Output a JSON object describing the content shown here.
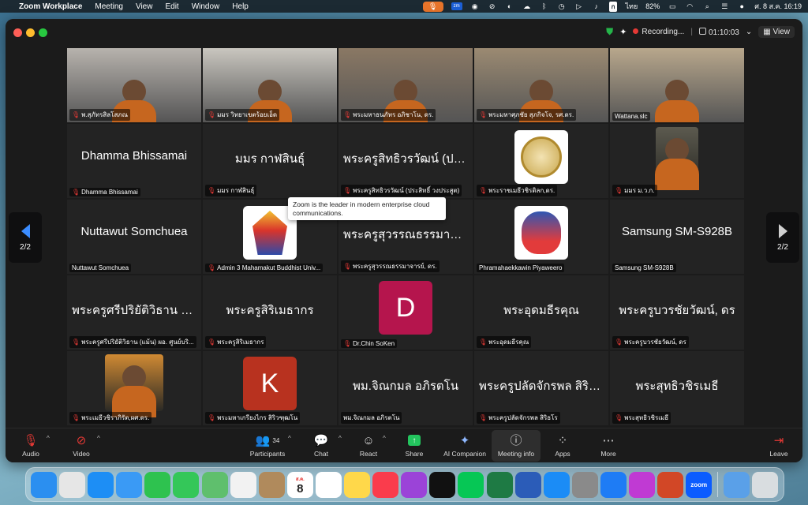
{
  "menubar": {
    "app_name": "Zoom Workplace",
    "items": [
      "Meeting",
      "View",
      "Edit",
      "Window",
      "Help"
    ],
    "zm_icon": "zm",
    "lang": "ไทย",
    "battery": "82%",
    "clock": "ศ. 8 ส.ค.  16:19"
  },
  "titlebar": {
    "recording": "Recording...",
    "timer": "01:10:03",
    "view": "View"
  },
  "nav": {
    "left_page": "2/2",
    "right_page": "2/2"
  },
  "tooltip": "Zoom is the leader in modern enterprise cloud communications.",
  "tiles": [
    {
      "type": "video",
      "tag": "พ.สุภัทรสิลโสภณ",
      "bg": "#b7b3ad"
    },
    {
      "type": "video",
      "tag": "มมร วิทยาเขตร้อยเอ็ด",
      "bg": "#c9c6bf"
    },
    {
      "type": "video",
      "tag": "พระมหาธนภัทร อภิชาโน, ดร.",
      "bg": "#8a7864"
    },
    {
      "type": "video",
      "tag": "พระมหาศุภชัย สุภกิจโจ, รศ.ดร.",
      "bg": "#9b8a72"
    },
    {
      "type": "video",
      "tag": "Wattana.slc",
      "bg": "#b8a78c",
      "muted": false
    },
    {
      "type": "name",
      "name": "Dhamma Bhissamai",
      "tag": "Dhamma Bhissamai"
    },
    {
      "type": "name",
      "name": "มมร กาฬสินธุ์",
      "tag": "มมร กาฬสินธุ์"
    },
    {
      "type": "name",
      "name": "พระครูสิทธิวรวัฒน์ (ประ...",
      "tag": "พระครูสิทธิวรวัฒน์ (ประสิทธิ์ วงประสูต)"
    },
    {
      "type": "logo",
      "tag": "พระราชเมธีวชิรดิลก,ดร.",
      "logo": "seal-gold"
    },
    {
      "type": "photo",
      "tag": "มมร ม.ว.ก.",
      "bg": "#5c5a4f"
    },
    {
      "type": "name",
      "name": "Nuttawut Somchuea",
      "tag": "Nuttawut Somchuea",
      "muted": false
    },
    {
      "type": "logo",
      "tag": "Admin 3 Mahamakut Buddhist Univ...",
      "logo": "university-crest"
    },
    {
      "type": "name",
      "name": "พระครูสุวรรณธรรมาจาร...",
      "tag": "พระครูสุวรรณธรรมาจารย์, ดร."
    },
    {
      "type": "logo",
      "tag": "Phramahaekkawin Piyaweero",
      "logo": "temple-seal",
      "muted": false
    },
    {
      "type": "name",
      "name": "Samsung SM-S928B",
      "tag": "Samsung SM-S928B",
      "muted": false
    },
    {
      "type": "name",
      "name": "พระครูศรีปริยัติวิธาน (แ...",
      "tag": "พระครูศรีปริยัติวิธาน (แม้น) ผอ. ศูนย์บริ..."
    },
    {
      "type": "name",
      "name": "พระครูสิริเมธากร",
      "tag": "พระครูสิริเมธากร"
    },
    {
      "type": "letter",
      "letter": "D",
      "color": "#b5154d",
      "tag": "Dr.Chin SoKen"
    },
    {
      "type": "name",
      "name": "พระอุดมธีรคุณ",
      "tag": "พระอุดมธีรคุณ"
    },
    {
      "type": "name",
      "name": "พระครูบวรชัยวัฒน์, ดร",
      "tag": "พระครูบวรชัยวัฒน์, ดร"
    },
    {
      "type": "photo",
      "tag": "พระเมธีวชิราภิรัต,ผศ.ดร.",
      "bg": "#d08a33",
      "small": true
    },
    {
      "type": "letter",
      "letter": "K",
      "color": "#b8321f",
      "tag": "พระมหาเกรียงไกร สิริวฑฺฒโน"
    },
    {
      "type": "name",
      "name": "พม.จิณกมล อภิรตโน",
      "tag": "พม.จิณกมล อภิรตโน",
      "muted": false
    },
    {
      "type": "name",
      "name": "พระครูปลัดจักรพล สิริธโร",
      "tag": "พระครูปลัดจักรพล สิริธโร"
    },
    {
      "type": "name",
      "name": "พระสุทธิวชิรเมธี",
      "tag": "พระสุทธิวชิรเมธี"
    }
  ],
  "toolbar": {
    "audio": "Audio",
    "video": "Video",
    "participants": "Participants",
    "participants_count": "34",
    "chat": "Chat",
    "react": "React",
    "share": "Share",
    "ai": "AI Companion",
    "info": "Meeting info",
    "apps": "Apps",
    "more": "More",
    "leave": "Leave"
  },
  "dock": {
    "calendar_month": "ส.ค.",
    "calendar_day": "8",
    "zoom_label": "zoom",
    "apps": [
      {
        "name": "finder",
        "color": "#2b8ff0"
      },
      {
        "name": "launchpad",
        "color": "#e6e6e6"
      },
      {
        "name": "safari",
        "color": "#1d8ef5"
      },
      {
        "name": "mail",
        "color": "#3a9af5"
      },
      {
        "name": "facetime",
        "color": "#2ec24f"
      },
      {
        "name": "messages",
        "color": "#34c759"
      },
      {
        "name": "maps",
        "color": "#5fbf6d"
      },
      {
        "name": "photos",
        "color": "#f2f2f2"
      },
      {
        "name": "contacts",
        "color": "#b08a5c"
      },
      {
        "name": "calendar",
        "color": "#ffffff"
      },
      {
        "name": "reminders",
        "color": "#ffffff"
      },
      {
        "name": "notes",
        "color": "#ffd84a"
      },
      {
        "name": "music",
        "color": "#fa3c4c"
      },
      {
        "name": "podcasts",
        "color": "#9b43d8"
      },
      {
        "name": "apple-tv",
        "color": "#111111"
      },
      {
        "name": "line",
        "color": "#06c755"
      },
      {
        "name": "excel",
        "color": "#1e7a44"
      },
      {
        "name": "word",
        "color": "#2b5cb8"
      },
      {
        "name": "app-store",
        "color": "#1b8cf6"
      },
      {
        "name": "system-settings",
        "color": "#8a8a8a"
      },
      {
        "name": "messenger",
        "color": "#1e7cf5"
      },
      {
        "name": "feedback",
        "color": "#c03ad3"
      },
      {
        "name": "powerpoint",
        "color": "#d24726"
      },
      {
        "name": "zoom",
        "color": "#0b5cff"
      },
      {
        "name": "downloads",
        "color": "#5aa0e8"
      },
      {
        "name": "trash",
        "color": "#d9dde0"
      }
    ]
  }
}
